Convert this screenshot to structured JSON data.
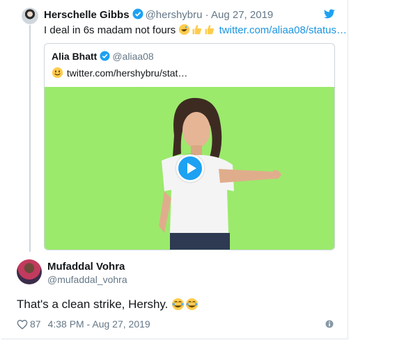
{
  "parent_tweet": {
    "name": "Herschelle Gibbs",
    "handle": "@hershybru",
    "separator": "·",
    "date": "Aug 27, 2019",
    "text": "I deal in 6s madam not fours",
    "link": "twitter.com/aliaa08/status…"
  },
  "quoted_tweet": {
    "name": "Alia Bhatt",
    "handle": "@aliaa08",
    "link": "twitter.com/hershybru/stat…"
  },
  "main_tweet": {
    "name": "Mufaddal Vohra",
    "handle": "@mufaddal_vohra",
    "text": "That's a clean strike, Hershy.",
    "likes": "87",
    "timestamp": "4:38 PM - Aug 27, 2019"
  },
  "colors": {
    "link": "#1b95e0",
    "verified": "#1da1f2",
    "muted": "#657786",
    "video_background": "#9bea6b"
  }
}
